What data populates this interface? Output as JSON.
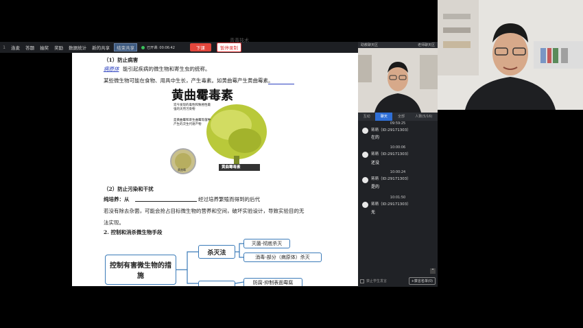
{
  "toolbar": {
    "page_num": "1",
    "items": [
      "连麦",
      "答题",
      "抽奖",
      "奖励",
      "数据统计",
      "新的共享",
      "结束共享"
    ],
    "timer": "已开课: 00:06:42",
    "down_label": "下课",
    "pause_label": "暂停录制"
  },
  "doc": {
    "top_fragment": "青毒技术",
    "s1_title": "（1）防止病害",
    "s1_blank_word": "病原体",
    "s1_line1": "能引起疾病的微生物和寄生虫的统称。",
    "s1_line2": "某些微生物可能在食物、用具中生长，产生毒素。如黄曲霉产生黄曲霉素。",
    "img_title": "黄曲霉毒素",
    "img_note1": "迄今发现的毒性和致癌性最强的天然污染物",
    "img_note2": "是黄曲霉和寄生曲霉等菌种产生的次生代谢产物",
    "img_label": "黄曲霉毒素",
    "img_label_small": "黄曲霉",
    "s2_title": "（2）防止污染和干扰",
    "s2_line1_a": "纯培养：从",
    "s2_line1_b": "经过培养繁殖而得到的后代",
    "s2_line2": "若没有除去杂菌，可能会抢占目标微生物的营养和空间，破坏实验设计，导致实验目的无",
    "s2_line3": "法实现。",
    "s3_title": "2. 控制和消杀微生物手段",
    "mm_root": "控制有害微生物的措施",
    "mm_branch1": "杀灭法",
    "mm_leaf1": "灭菌-彻底杀灭",
    "mm_leaf2": "消毒-部分（病原体）杀灭",
    "mm_leaf3": "防腐-抑制表面霉腐"
  },
  "chat": {
    "header_left": "助教聊天区",
    "header_right": "老师聊天区",
    "tabs": [
      "互动",
      "聊天",
      "全部",
      "人数(5/16)"
    ],
    "messages": [
      {
        "time": "09:59:25",
        "user": "蒋萌（ID:29171303）",
        "text": "在的"
      },
      {
        "time": "10:00:06",
        "user": "蒋萌（ID:29171303）",
        "text": "还没"
      },
      {
        "time": "10:00:24",
        "user": "蒋萌（ID:29171303）",
        "text": "是的"
      },
      {
        "time": "10:01:50",
        "user": "蒋萌（ID:29171303）",
        "text": "无"
      }
    ],
    "footer_checkbox": "禁止学生发言",
    "footer_button": "+禁言名单(0)"
  },
  "colors": {
    "accent": "#2f6fd6",
    "down_button": "#e2463c",
    "mindmap_border": "#3a7ab8"
  }
}
